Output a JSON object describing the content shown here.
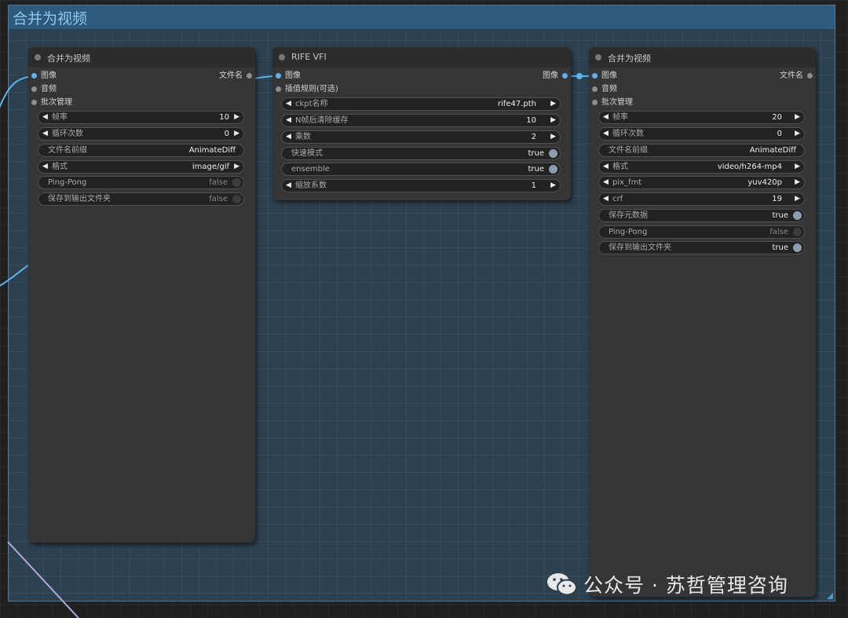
{
  "group": {
    "title": "合并为视频"
  },
  "node1": {
    "title": "合并为视频",
    "inputs": [
      "图像",
      "音频",
      "批次管理"
    ],
    "output": "文件名",
    "widgets": [
      {
        "label": "帧率",
        "value": "10"
      },
      {
        "label": "循环次数",
        "value": "0"
      },
      {
        "label": "文件名前缀",
        "value": "AnimateDiff"
      },
      {
        "label": "格式",
        "value": "image/gif"
      },
      {
        "label": "Ping-Pong",
        "value": "false"
      },
      {
        "label": "保存到输出文件夹",
        "value": "false"
      }
    ]
  },
  "node2": {
    "title": "RIFE VFI",
    "inputs": [
      "图像",
      "插值规则(可选)"
    ],
    "output": "图像",
    "widgets": [
      {
        "label": "ckpt名称",
        "value": "rife47.pth"
      },
      {
        "label": "N帧后清除缓存",
        "value": "10"
      },
      {
        "label": "乘数",
        "value": "2"
      },
      {
        "label": "快速模式",
        "value": "true"
      },
      {
        "label": "ensemble",
        "value": "true"
      },
      {
        "label": "缩放系数",
        "value": "1"
      }
    ]
  },
  "node3": {
    "title": "合并为视频",
    "inputs": [
      "图像",
      "音频",
      "批次管理"
    ],
    "output": "文件名",
    "widgets": [
      {
        "label": "帧率",
        "value": "20"
      },
      {
        "label": "循环次数",
        "value": "0"
      },
      {
        "label": "文件名前缀",
        "value": "AnimateDiff"
      },
      {
        "label": "格式",
        "value": "video/h264-mp4"
      },
      {
        "label": "pix_fmt",
        "value": "yuv420p"
      },
      {
        "label": "crf",
        "value": "19"
      },
      {
        "label": "保存元数据",
        "value": "true"
      },
      {
        "label": "Ping-Pong",
        "value": "false"
      },
      {
        "label": "保存到输出文件夹",
        "value": "true"
      }
    ]
  },
  "watermark": {
    "text": "公众号 · 苏哲管理咨询",
    "icon": "wechat-icon"
  },
  "colors": {
    "link_image": "#62b0ea",
    "link_other": "#b7a7dc",
    "group_header": "#2f5a7c",
    "group_title": "#8fc7ee"
  }
}
